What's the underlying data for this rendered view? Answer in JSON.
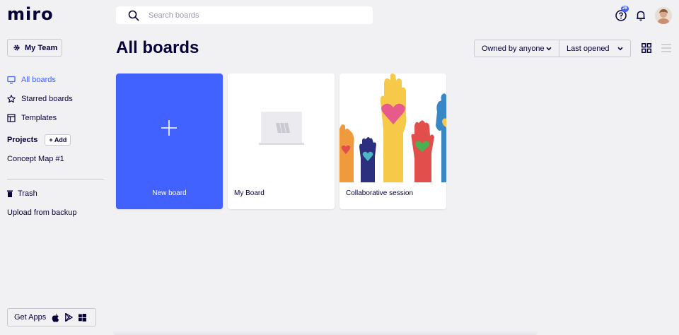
{
  "app": {
    "logo": "miro"
  },
  "search": {
    "placeholder": "Search boards"
  },
  "header": {
    "notification_count": "26"
  },
  "sidebar": {
    "team_label": "My Team",
    "nav": [
      {
        "label": "All boards",
        "icon": "boards-icon",
        "active": true
      },
      {
        "label": "Starred boards",
        "icon": "star-icon",
        "active": false
      },
      {
        "label": "Templates",
        "icon": "template-icon",
        "active": false
      }
    ],
    "projects_title": "Projects",
    "add_label": "+ Add",
    "projects": [
      "Concept Map #1"
    ],
    "trash_label": "Trash",
    "upload_label": "Upload from backup",
    "get_apps_label": "Get Apps"
  },
  "main": {
    "title": "All boards",
    "filter_owner": "Owned by anyone",
    "filter_sort": "Last opened",
    "boards": [
      {
        "name": "New board",
        "kind": "new"
      },
      {
        "name": "My Board",
        "kind": "blank"
      },
      {
        "name": "Collaborative session",
        "kind": "image"
      }
    ]
  },
  "colors": {
    "accent": "#4262ff",
    "text": "#050038",
    "background": "#f1f1f4"
  }
}
